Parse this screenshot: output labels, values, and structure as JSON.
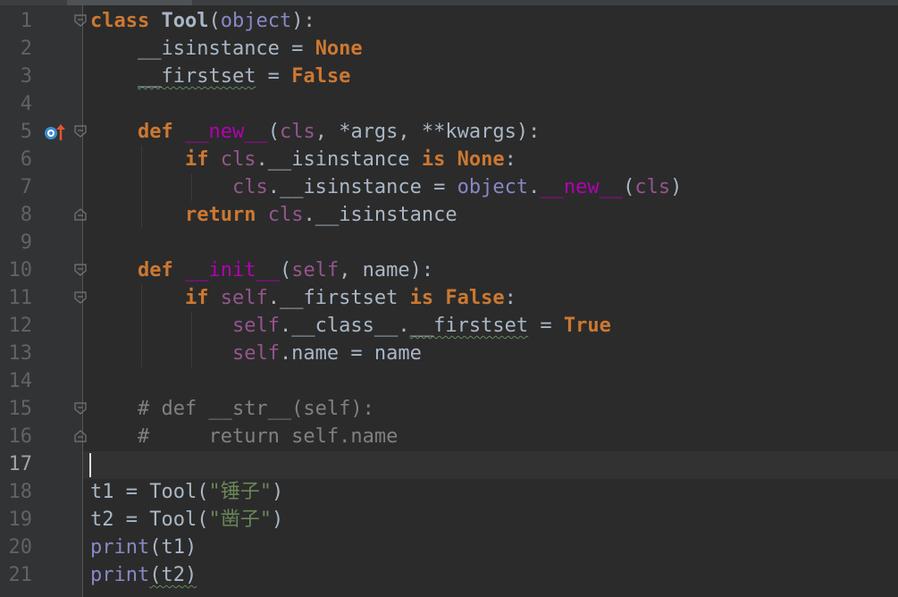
{
  "editor": {
    "language": "python",
    "current_line": 17,
    "lines": [
      {
        "n": "1"
      },
      {
        "n": "2"
      },
      {
        "n": "3"
      },
      {
        "n": "4"
      },
      {
        "n": "5"
      },
      {
        "n": "6"
      },
      {
        "n": "7"
      },
      {
        "n": "8"
      },
      {
        "n": "9"
      },
      {
        "n": "10"
      },
      {
        "n": "11"
      },
      {
        "n": "12"
      },
      {
        "n": "13"
      },
      {
        "n": "14"
      },
      {
        "n": "15"
      },
      {
        "n": "16"
      },
      {
        "n": "17"
      },
      {
        "n": "18"
      },
      {
        "n": "19"
      },
      {
        "n": "20"
      },
      {
        "n": "21"
      }
    ],
    "tokens": {
      "l1_class": "class",
      "l1_name": "Tool",
      "l1_paren_open": "(",
      "l1_object": "object",
      "l1_tail": "):",
      "l2_attr": "__isinstance",
      "l2_eq": " = ",
      "l2_none": "None",
      "l3_attr": "__firstset",
      "l3_eq": " = ",
      "l3_false": "False",
      "l5_def": "def",
      "l5_name": "__new__",
      "l5_open": "(",
      "l5_cls": "cls",
      "l5_rest": ", *args, **kwargs):",
      "l6_if": "if",
      "l6_cls": "cls",
      "l6_attr": ".__isinstance ",
      "l6_is": "is",
      "l6_none": "None",
      "l6_colon": ":",
      "l7_cls": "cls",
      "l7_attr": ".__isinstance = ",
      "l7_object": "object",
      "l7_dot": ".",
      "l7_new": "__new__",
      "l7_open": "(",
      "l7_cls2": "cls",
      "l7_close": ")",
      "l8_return": "return",
      "l8_cls": "cls",
      "l8_attr": ".__isinstance",
      "l10_def": "def",
      "l10_name": "__init__",
      "l10_open": "(",
      "l10_self": "self",
      "l10_rest": ", name):",
      "l11_if": "if",
      "l11_self": "self",
      "l11_attr": ".__firstset ",
      "l11_is": "is",
      "l11_false": "False",
      "l11_colon": ":",
      "l12_self": "self",
      "l12_dot": ".",
      "l12_class": "__class__",
      "l12_dot2": ".",
      "l12_first": "__firstset",
      "l12_eq": " = ",
      "l12_true": "True",
      "l13_self": "self",
      "l13_rest": ".name = name",
      "l15_comment": "# def __str__(self):",
      "l16_comment": "#     return self.name",
      "l18_pre": "t1 = Tool(",
      "l18_str": "\"锤子\"",
      "l18_post": ")",
      "l19_pre": "t2 = Tool(",
      "l19_str": "\"凿子\"",
      "l19_post": ")",
      "l20_print": "print",
      "l20_rest": "(t1)",
      "l21_print": "print",
      "l21_rest": "(t2)"
    }
  },
  "icons": {
    "override": "overrides-method-icon",
    "fold": "fold-icon"
  },
  "colors": {
    "background": "#2b2b2b",
    "gutter": "#313335",
    "keyword": "#cc7832",
    "string": "#6a8759",
    "comment": "#808080",
    "self": "#94558d",
    "magic": "#b200b2",
    "builtin": "#8888c6",
    "text": "#a9b7c6"
  }
}
